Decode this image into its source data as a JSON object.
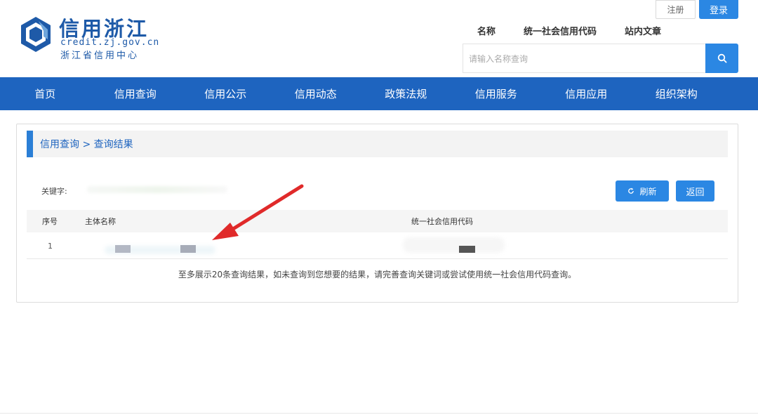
{
  "header": {
    "logo_title": "信用浙江",
    "logo_url": "credit.zj.gov.cn",
    "logo_subtitle": "浙江省信用中心",
    "register_label": "注册",
    "login_label": "登录",
    "search_tabs": [
      "名称",
      "统一社会信用代码",
      "站内文章"
    ],
    "search_placeholder": "请输入名称查询",
    "search_icon": "search-icon"
  },
  "nav": {
    "items": [
      "首页",
      "信用查询",
      "信用公示",
      "信用动态",
      "政策法规",
      "信用服务",
      "信用应用",
      "组织架构"
    ]
  },
  "panel": {
    "breadcrumb": "信用查询 > 查询结果",
    "keyword_label": "关键字:",
    "refresh_label": "刷新",
    "refresh_icon": "refresh-icon",
    "back_label": "返回",
    "columns": [
      "序号",
      "主体名称",
      "统一社会信用代码"
    ],
    "rows": [
      {
        "index": "1"
      }
    ],
    "note": "至多展示20条查询结果，如未查询到您想要的结果，请完善查询关键词或尝试使用统一社会信用代码查询。"
  },
  "colors": {
    "brand_blue": "#1e64bf",
    "button_blue": "#2b87e3",
    "arrow_red": "#e02a2a"
  }
}
